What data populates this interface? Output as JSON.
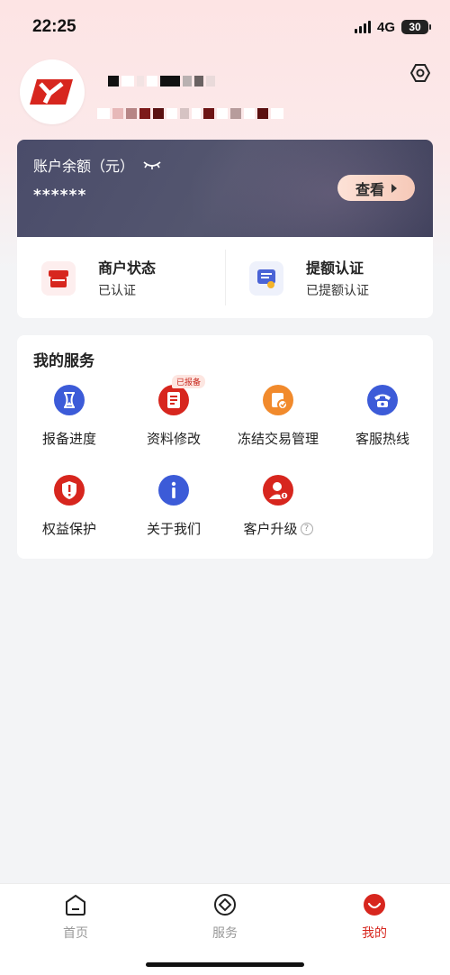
{
  "status_bar": {
    "time": "22:25",
    "network": "4G",
    "battery": "30"
  },
  "balance": {
    "title": "账户余额（元）",
    "value": "******",
    "view_button": "查看"
  },
  "status_items": [
    {
      "name": "商户状态",
      "sub": "已认证",
      "icon": "store-icon"
    },
    {
      "name": "提额认证",
      "sub": "已提额认证",
      "icon": "certificate-icon"
    }
  ],
  "services": {
    "title": "我的服务",
    "badge": "已报备",
    "items": [
      {
        "label": "报备进度",
        "icon": "hourglass-icon",
        "color": "#3c5bd8"
      },
      {
        "label": "资料修改",
        "icon": "document-edit-icon",
        "color": "#d7261e"
      },
      {
        "label": "冻结交易管理",
        "icon": "frozen-transaction-icon",
        "color": "#f18a2c"
      },
      {
        "label": "客服热线",
        "icon": "phone-icon",
        "color": "#3c5bd8"
      },
      {
        "label": "权益保护",
        "icon": "shield-icon",
        "color": "#d7261e"
      },
      {
        "label": "关于我们",
        "icon": "info-icon",
        "color": "#3c5bd8"
      },
      {
        "label": "客户升级",
        "icon": "user-upgrade-icon",
        "color": "#d7261e",
        "help": "?"
      }
    ]
  },
  "tabbar": {
    "items": [
      {
        "label": "首页",
        "icon": "home-icon",
        "active": false
      },
      {
        "label": "服务",
        "icon": "diamond-service-icon",
        "active": false
      },
      {
        "label": "我的",
        "icon": "smile-profile-icon",
        "active": true
      }
    ]
  },
  "colors": {
    "brand": "#d7261e",
    "accent_blue": "#3c5bd8",
    "card_dark": "#4a4c6a"
  }
}
